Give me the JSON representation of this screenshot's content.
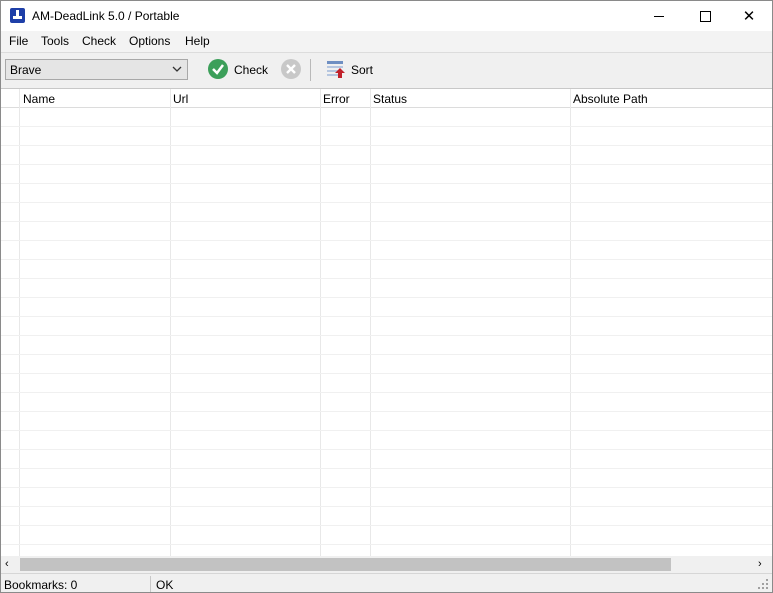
{
  "window": {
    "title": "AM-DeadLink 5.0 / Portable",
    "minimize_label": "—",
    "maximize_label": "☐",
    "close_label": "✕"
  },
  "menu": [
    {
      "label": "File"
    },
    {
      "label": "Tools"
    },
    {
      "label": "Check"
    },
    {
      "label": "Options"
    },
    {
      "label": "Help"
    }
  ],
  "toolbar": {
    "browser_select": "Brave",
    "check_label": "Check",
    "sort_label": "Sort",
    "icons": {
      "check": "check-circle-icon",
      "stop": "stop-circle-icon",
      "sort": "sort-icon"
    },
    "colors": {
      "check": "#3c9f5a",
      "stop_disabled": "#c8c8c8",
      "sort_arrow": "#c0202a"
    }
  },
  "table": {
    "columns": [
      "Name",
      "Url",
      "Error",
      "Status",
      "Absolute Path"
    ],
    "rows": []
  },
  "scrollbar": {
    "left_arrow": "‹",
    "right_arrow": "›"
  },
  "status": {
    "bookmarks": "Bookmarks: 0",
    "message": "OK"
  },
  "colors": {
    "app_icon": "#1e3fa8"
  }
}
